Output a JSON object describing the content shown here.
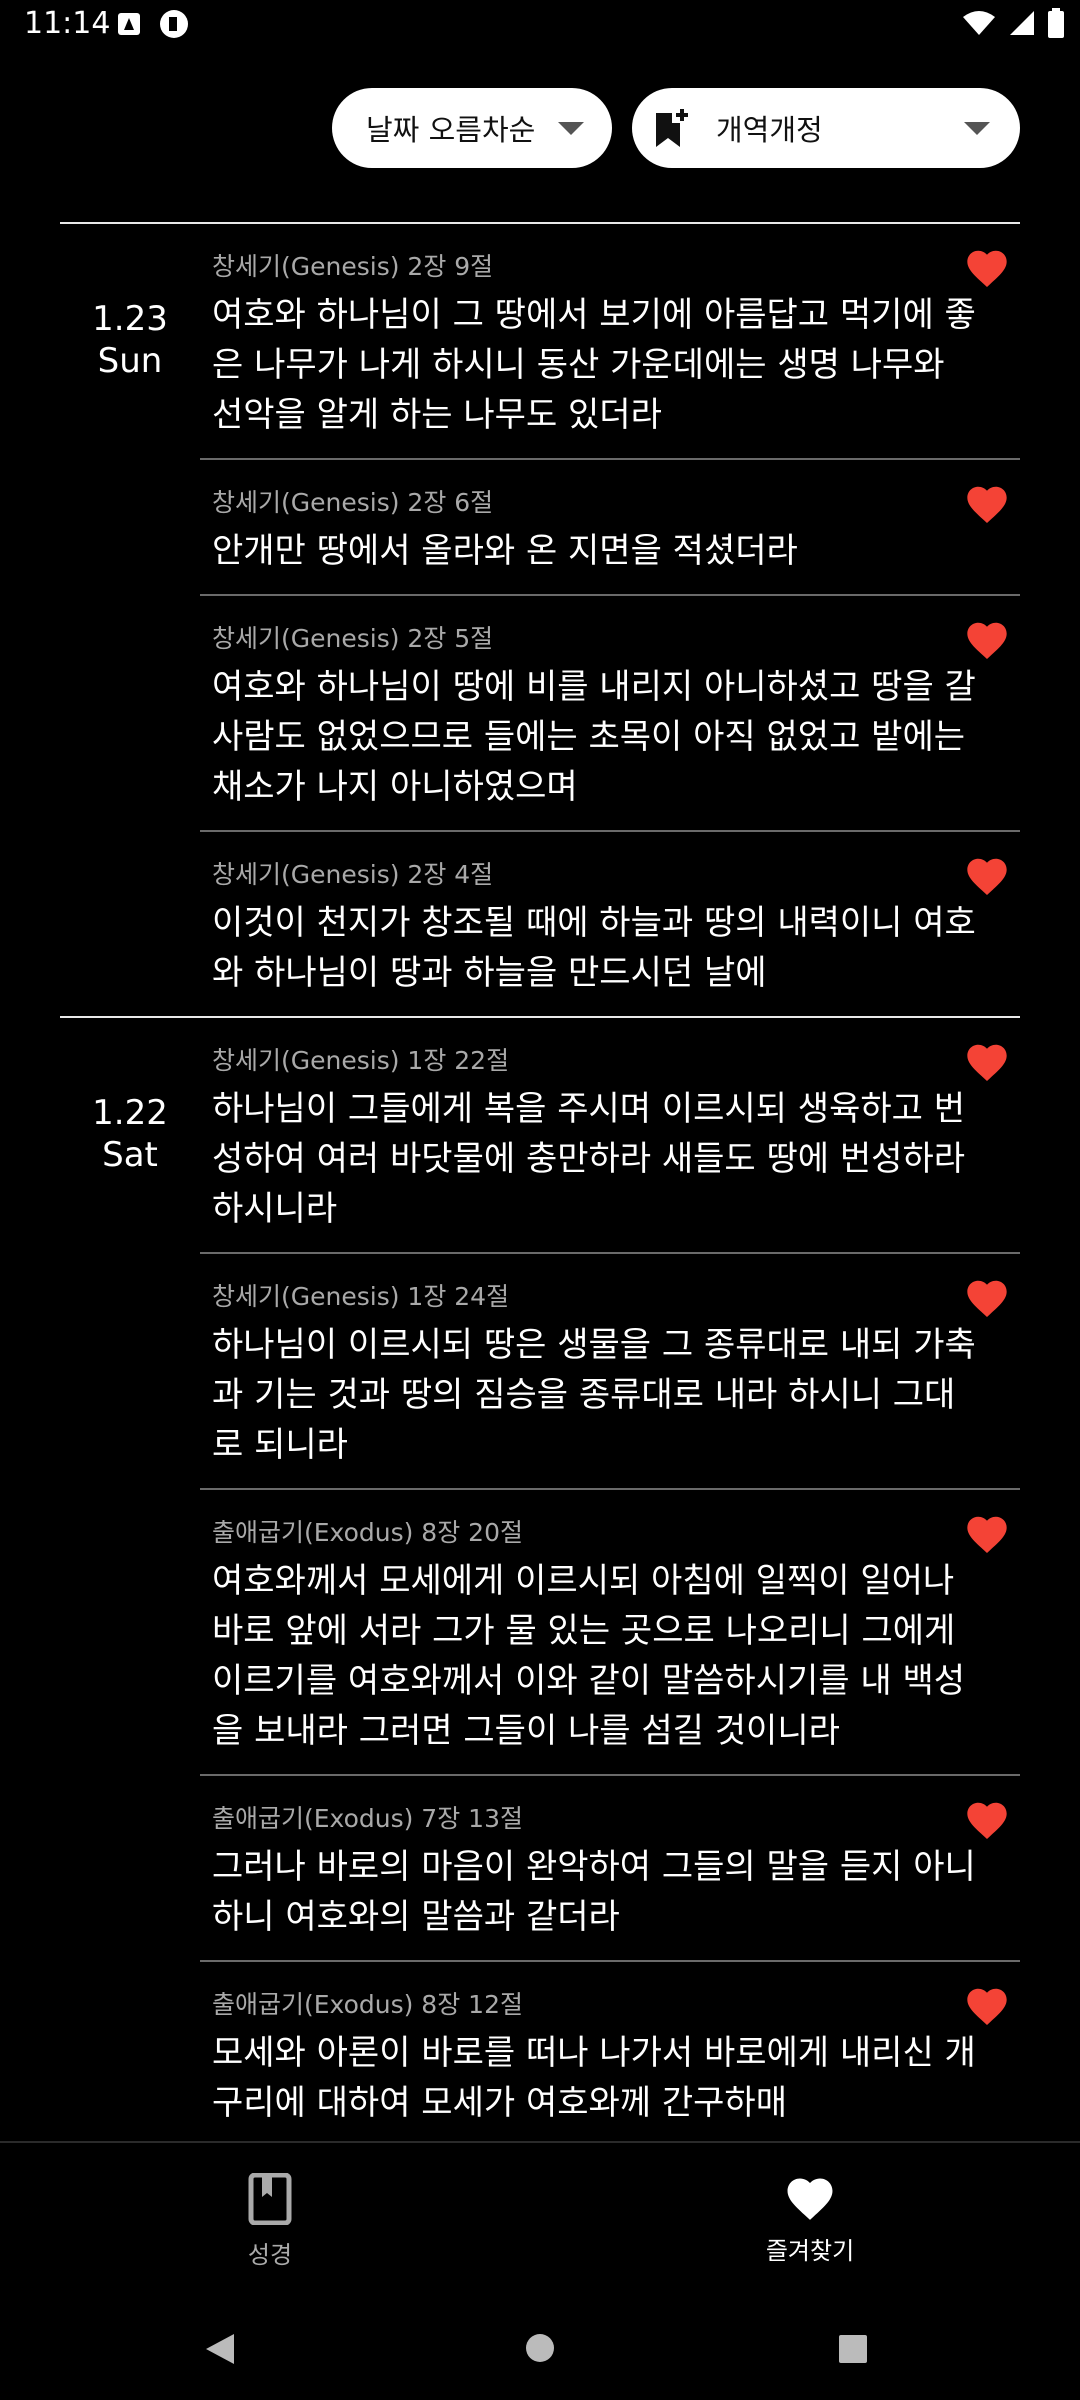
{
  "status": {
    "time": "11:14"
  },
  "controls": {
    "sort_label": "날짜 오름차순",
    "version_label": "개역개정"
  },
  "groups": [
    {
      "date": "1.23",
      "weekday": "Sun",
      "verses": [
        {
          "ref": "창세기(Genesis) 2장 9절",
          "text": "여호와 하나님이 그 땅에서 보기에 아름답고 먹기에 좋은 나무가 나게 하시니 동산 가운데에는 생명 나무와 선악을 알게 하는 나무도 있더라"
        },
        {
          "ref": "창세기(Genesis) 2장 6절",
          "text": "안개만 땅에서 올라와 온 지면을 적셨더라"
        },
        {
          "ref": "창세기(Genesis) 2장 5절",
          "text": "여호와 하나님이 땅에 비를 내리지 아니하셨고 땅을 갈 사람도 없었으므로 들에는 초목이 아직 없었고 밭에는 채소가 나지 아니하였으며"
        },
        {
          "ref": "창세기(Genesis) 2장 4절",
          "text": "이것이 천지가 창조될 때에 하늘과 땅의 내력이니 여호와 하나님이 땅과 하늘을 만드시던 날에"
        }
      ]
    },
    {
      "date": "1.22",
      "weekday": "Sat",
      "verses": [
        {
          "ref": "창세기(Genesis) 1장 22절",
          "text": "하나님이 그들에게 복을 주시며 이르시되 생육하고 번성하여 여러 바닷물에 충만하라 새들도 땅에 번성하라 하시니라"
        },
        {
          "ref": "창세기(Genesis) 1장 24절",
          "text": "하나님이 이르시되 땅은 생물을 그 종류대로 내되 가축과 기는 것과 땅의 짐승을 종류대로 내라 하시니 그대로 되니라"
        },
        {
          "ref": "출애굽기(Exodus) 8장 20절",
          "text": "여호와께서 모세에게 이르시되 아침에 일찍이 일어나 바로 앞에 서라 그가 물 있는 곳으로 나오리니 그에게 이르기를 여호와께서 이와 같이 말씀하시기를 내 백성을 보내라 그러면 그들이 나를 섬길 것이니라"
        },
        {
          "ref": "출애굽기(Exodus) 7장 13절",
          "text": "그러나 바로의 마음이 완악하여 그들의 말을 듣지 아니하니 여호와의 말씀과 같더라"
        },
        {
          "ref": "출애굽기(Exodus) 8장 12절",
          "text": "모세와 아론이 바로를 떠나 나가서 바로에게 내리신 개구리에 대하여 모세가 여호와께 간구하매"
        },
        {
          "ref": "",
          "text": ""
        }
      ]
    }
  ],
  "nav": {
    "bible_label": "성경",
    "favorites_label": "즐겨찾기"
  },
  "colors": {
    "accent_heart": "#f44336",
    "background": "#000000"
  }
}
